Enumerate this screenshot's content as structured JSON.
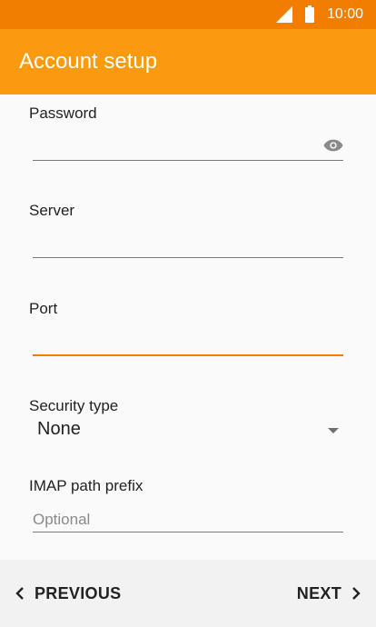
{
  "status_bar": {
    "time": "10:00"
  },
  "app_bar": {
    "title": "Account setup"
  },
  "form": {
    "password": {
      "label": "Password",
      "value": ""
    },
    "server": {
      "label": "Server",
      "value": ""
    },
    "port": {
      "label": "Port",
      "value": ""
    },
    "security_type": {
      "label": "Security type",
      "value": "None"
    },
    "imap_path_prefix": {
      "label": "IMAP path prefix",
      "placeholder": "Optional",
      "value": ""
    }
  },
  "nav": {
    "previous": "PREVIOUS",
    "next": "NEXT"
  },
  "colors": {
    "status_bar": "#f07e00",
    "app_bar": "#fb9a0e",
    "accent_line": "#f07e00"
  },
  "icons": {
    "password_toggle": "eye-icon",
    "dropdown": "dropdown-arrow-icon",
    "previous": "chevron-left-icon",
    "next": "chevron-right-icon"
  }
}
